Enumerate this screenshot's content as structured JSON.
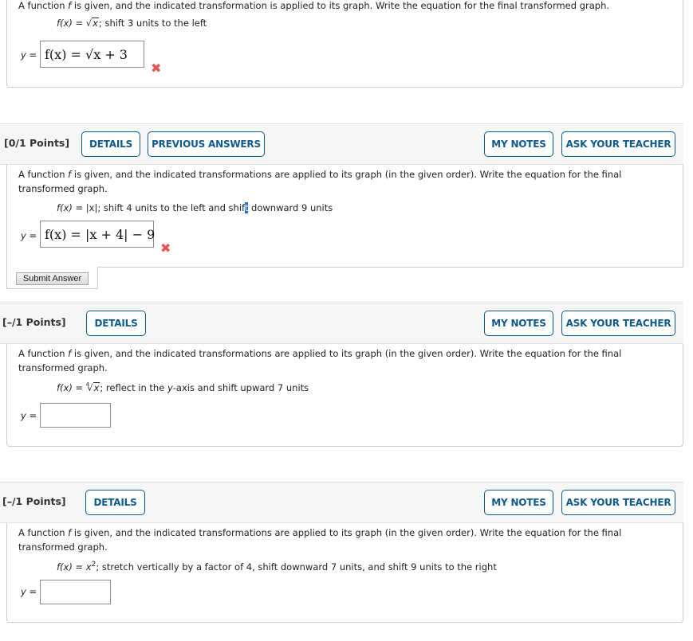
{
  "questions": [
    {
      "prompt_pre": "A function ",
      "prompt_var": "f",
      "prompt_post": " is given, and the indicated transformation is applied to its graph. Write the equation for the final transformed graph.",
      "given_fx": "f(x)",
      "given_eq": " = ",
      "given_rad": "x",
      "given_rest": ";  shift 3 units to the left",
      "y_label": "y",
      "y_eq": " =",
      "answer_value": "f(x) = √x + 3",
      "status": "incorrect",
      "status_icon": "✖"
    },
    {
      "points": "[0/1 Points]",
      "buttons": {
        "details": "DETAILS",
        "previous_answers": "PREVIOUS ANSWERS",
        "my_notes": "MY NOTES",
        "ask_teacher": "ASK YOUR TEACHER"
      },
      "prompt_pre": "A function ",
      "prompt_var": "f",
      "prompt_post": " is given, and the indicated transformations are applied to its graph (in the given order). Write the equation for the final transformed graph.",
      "given_fx": "f(x)",
      "given_rest_a": " = |x|;  shift 4 units to the left and shif",
      "given_hl": "t",
      "given_rest_b": " downward 9 units",
      "y_label": "y",
      "y_eq": " =",
      "answer_value": "f(x) = |x + 4| − 9",
      "status": "incorrect",
      "status_icon": "✖",
      "submit_label": "Submit Answer"
    },
    {
      "points": "[–/1 Points]",
      "buttons": {
        "details": "DETAILS",
        "my_notes": "MY NOTES",
        "ask_teacher": "ASK YOUR TEACHER"
      },
      "prompt_pre": "A function ",
      "prompt_var": "f",
      "prompt_post": " is given, and the indicated transformations are applied to its graph (in the given order). Write the equation for the final transformed graph.",
      "given_fx": "f(x)",
      "given_eq": " = ",
      "given_index": "4",
      "given_rad": "x",
      "given_rest_a": ";  reflect in the ",
      "given_yaxis": "y",
      "given_rest_b": "-axis and shift upward 7 units",
      "y_label": "y",
      "y_eq": " =",
      "answer_value": ""
    },
    {
      "points": "[–/1 Points]",
      "buttons": {
        "details": "DETAILS",
        "my_notes": "MY NOTES",
        "ask_teacher": "ASK YOUR TEACHER"
      },
      "prompt_pre": "A function ",
      "prompt_var": "f",
      "prompt_post": " is given, and the indicated transformations are applied to its graph (in the given order). Write the equation for the final transformed graph.",
      "given_fx": "f(x)",
      "given_eq": " = ",
      "given_base": "x",
      "given_exp": "2",
      "given_rest": ";  stretch vertically by a factor of 4, shift downward 7 units, and shift 9 units to the right",
      "y_label": "y",
      "y_eq": " =",
      "answer_value": ""
    }
  ],
  "colors": {
    "accent": "#0e5a8a",
    "error": "#e85454",
    "header_bg": "#f6f6f6",
    "border": "#cccccc"
  }
}
